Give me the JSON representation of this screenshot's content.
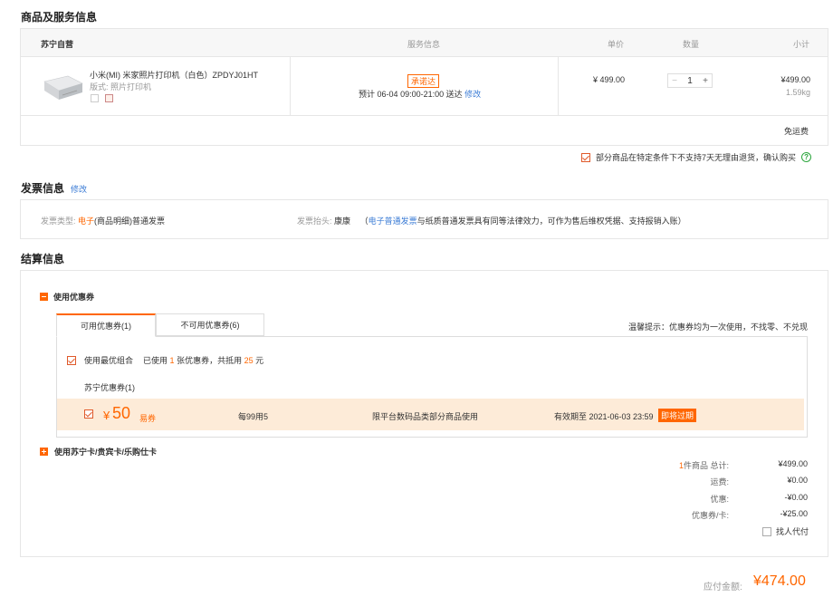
{
  "goods": {
    "section_title": "商品及服务信息",
    "header": {
      "seller": "苏宁自营",
      "service": "服务信息",
      "price": "单价",
      "qty": "数量",
      "subtotal": "小计"
    },
    "item": {
      "name": "小米(MI) 米家照片打印机（白色）ZPDYJ01HT",
      "spec_label": "版式:",
      "spec_value": "照片打印机",
      "badge": "承诺达",
      "delivery_prefix": "预计",
      "delivery_date": "06-04",
      "delivery_time": "09:00-21:00 送达",
      "modify": "修改",
      "unit_price": "¥ 499.00",
      "qty": "1",
      "minus": "−",
      "plus": "+",
      "subtotal": "¥499.00",
      "weight": "1.59kg"
    },
    "shipping": "免运费",
    "notice": "部分商品在特定条件下不支持7天无理由退货，确认购买",
    "help_icon": "?"
  },
  "invoice": {
    "section_title": "发票信息",
    "modify": "修改",
    "type_label": "发票类型:",
    "type_highlight": "电子",
    "type_value": "(商品明细)普通发票",
    "header_label": "发票抬头:",
    "header_value": "康康",
    "note_open": "（",
    "note_link": "电子普通发票",
    "note_rest": "与纸质普通发票具有同等法律效力，可作为售后维权凭据、支持报销入账）"
  },
  "settlement": {
    "section_title": "结算信息",
    "use_coupon": "使用优惠券",
    "tabs": [
      "可用优惠券(1)",
      "不可用优惠券(6)"
    ],
    "tip": "温馨提示：优惠券均为一次使用，不找零、不兑现",
    "best_combo": "使用最优组合",
    "used_prefix": "已使用",
    "used_count": "1",
    "used_mid": "张优惠券，共抵用",
    "used_amount": "25",
    "used_suffix": "元",
    "group_title": "苏宁优惠券(1)",
    "coupon": {
      "currency": "¥",
      "amount": "50",
      "type": "易券",
      "rule": "每99用5",
      "scope": "限平台数码品类部分商品使用",
      "expire": "有效期至 2021-06-03 23:59",
      "expiring": "即将过期"
    },
    "use_card": "使用苏宁卡/贵宾卡/乐购仕卡"
  },
  "summary": {
    "count": "1",
    "count_label": "件商品 总计:",
    "total": "¥499.00",
    "shipping_label": "运费:",
    "shipping": "¥0.00",
    "discount_label": "优惠:",
    "discount": "-¥0.00",
    "coupon_label": "优惠券/卡:",
    "coupon": "-¥25.00",
    "proxy_pay": "找人代付",
    "payable_label": "应付金额:",
    "payable": "¥474.00"
  },
  "colors": {
    "accent": "#ff6600",
    "link": "#3a7bd5",
    "coupon_bg": "#fdebd8"
  }
}
